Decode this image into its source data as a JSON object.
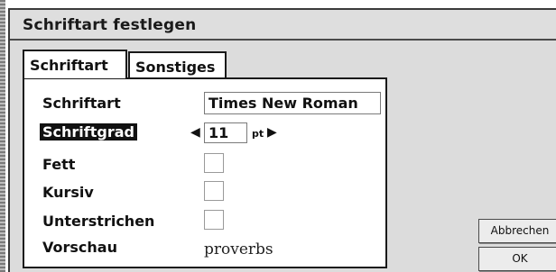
{
  "window": {
    "title": "Schriftart festlegen"
  },
  "tabs": [
    {
      "label": "Schriftart",
      "active": true
    },
    {
      "label": "Sonstiges",
      "active": false
    }
  ],
  "fields": {
    "font": {
      "label": "Schriftart",
      "value": "Times New Roman"
    },
    "size": {
      "label": "Schriftgrad",
      "value": "11",
      "unit": "pt",
      "decrement_icon": "triangle-left",
      "increment_icon": "triangle-right"
    },
    "bold": {
      "label": "Fett",
      "checked": false
    },
    "italic": {
      "label": "Kursiv",
      "checked": false
    },
    "underline": {
      "label": "Unterstrichen",
      "checked": false
    },
    "preview": {
      "label": "Vorschau",
      "text": "proverbs"
    }
  },
  "buttons": {
    "cancel": "Abbrechen",
    "ok": "OK"
  }
}
